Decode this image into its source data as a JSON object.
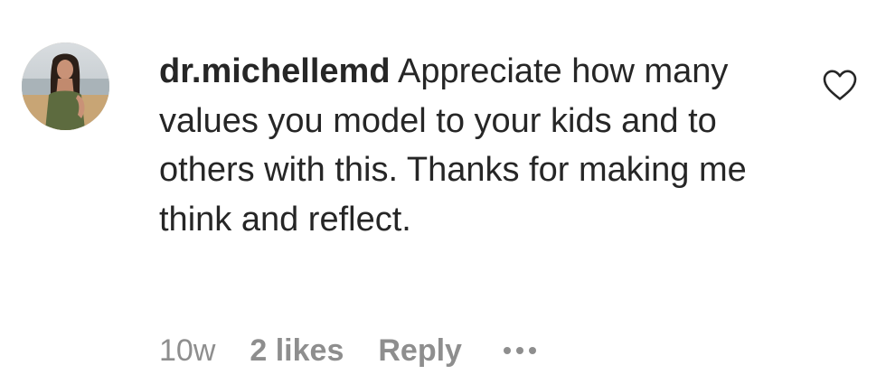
{
  "comment": {
    "avatar_icon": "profile-photo",
    "username": "dr.michellemd",
    "text": "Appreciate how many values you model to your kids and to others with this. Thanks for making me think and reflect.",
    "like_icon": "heart-outline-icon"
  },
  "meta": {
    "time": "10w",
    "likes": "2 likes",
    "reply": "Reply",
    "more_icon": "more-horizontal-icon"
  },
  "colors": {
    "primary_text": "#262626",
    "secondary_text": "#8e8e8e",
    "background": "#ffffff"
  }
}
